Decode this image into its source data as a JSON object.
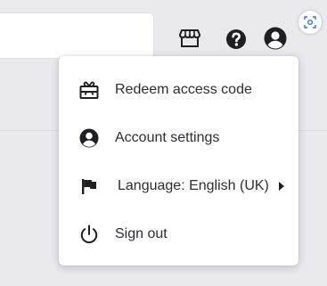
{
  "header": {
    "icons": [
      "store-icon",
      "help-icon",
      "account-icon",
      "screenshot-focus-icon"
    ]
  },
  "menu": {
    "items": [
      {
        "label": "Redeem access code",
        "icon": "gift-icon"
      },
      {
        "label": "Account settings",
        "icon": "account-circle-icon"
      },
      {
        "label": "Language: English (UK)",
        "icon": "flag-icon",
        "submenu": true
      },
      {
        "label": "Sign out",
        "icon": "power-icon"
      }
    ]
  },
  "colors": {
    "background": "#e9e9ee",
    "menu_background": "#ffffff",
    "text": "#2e2e33",
    "icon": "#1f1f23"
  }
}
